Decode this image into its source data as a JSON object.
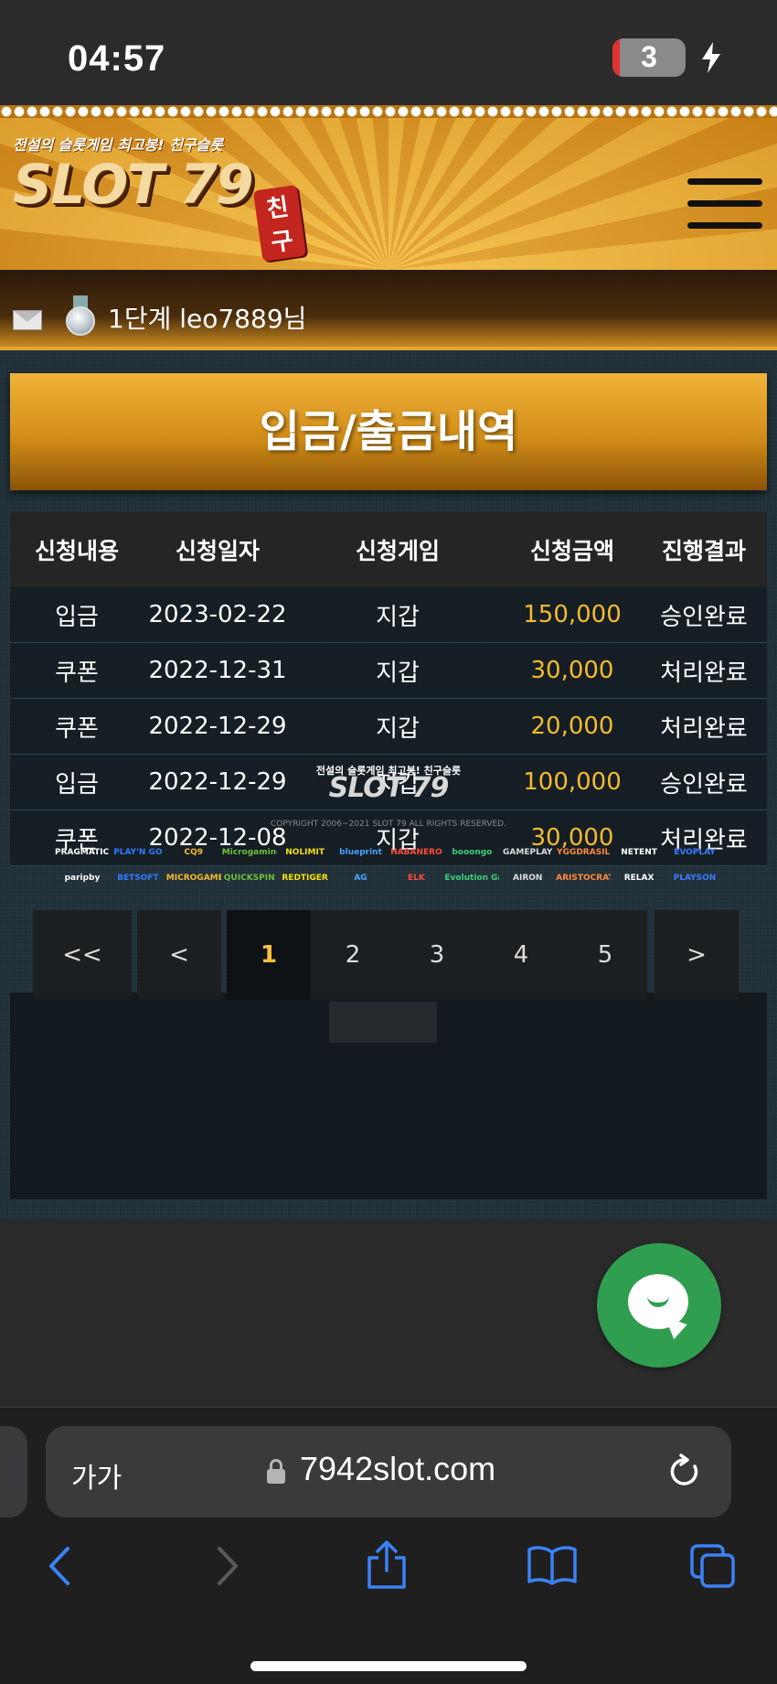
{
  "status": {
    "time": "04:57",
    "battery": "3"
  },
  "header": {
    "tagline": "전설의 슬롯게임 최고봉! 친구슬롯",
    "logo": "SLOT 79",
    "logo_tag": "친구"
  },
  "user": {
    "level_name": "1단계 leo7889님"
  },
  "page": {
    "title": "입금/출금내역"
  },
  "table": {
    "headers": [
      "신청내용",
      "신청일자",
      "신청게임",
      "신청금액",
      "진행결과"
    ],
    "rows": [
      [
        "입금",
        "2023-02-22",
        "지갑",
        "150,000",
        "승인완료"
      ],
      [
        "쿠폰",
        "2022-12-31",
        "지갑",
        "30,000",
        "처리완료"
      ],
      [
        "쿠폰",
        "2022-12-29",
        "지갑",
        "20,000",
        "처리완료"
      ],
      [
        "입금",
        "2022-12-29",
        "지갑",
        "100,000",
        "승인완료"
      ],
      [
        "쿠폰",
        "2022-12-08",
        "지갑",
        "30,000",
        "처리완료"
      ]
    ]
  },
  "pagination": {
    "first": "<<",
    "prev": "<",
    "pages": [
      "1",
      "2",
      "3",
      "4",
      "5"
    ],
    "next": ">",
    "current": "1"
  },
  "footer": {
    "tagline": "전설의 슬롯게임 최고봉! 친구슬롯",
    "logo": "SLOT 79",
    "copyright": "COPYRIGHT 2006~2021 SLOT 79 ALL RIGHTS RESERVED.",
    "providers_row1": [
      "PRAGMATIC PLAY",
      "PLAY'N GO",
      "CQ9",
      "Microgaming",
      "NOLIMIT",
      "blueprint",
      "HABANERO",
      "booongo",
      "GAMEPLAY",
      "YGGDRASIL",
      "NETENT",
      "EVOPLAY"
    ],
    "providers_row2": [
      "paripby",
      "BETSOFT",
      "MICROGAMES",
      "QUICKSPIN",
      "REDTIGER",
      "AG",
      "ELK",
      "Evolution Gaming",
      "AIRON",
      "ARISTOCRAT",
      "RELAX",
      "PLAYSON"
    ],
    "provider_colors": [
      "#ffffff",
      "#2f7bff",
      "#f6b92f",
      "#6fbf3a",
      "#f6e000",
      "#4aa3ff",
      "#ff4a3a",
      "#3ccf7a",
      "#dddddd",
      "#ff8a3a",
      "#ffffff",
      "#3a7bff"
    ]
  },
  "browser": {
    "text_size": "가가",
    "url": "7942slot.com"
  }
}
